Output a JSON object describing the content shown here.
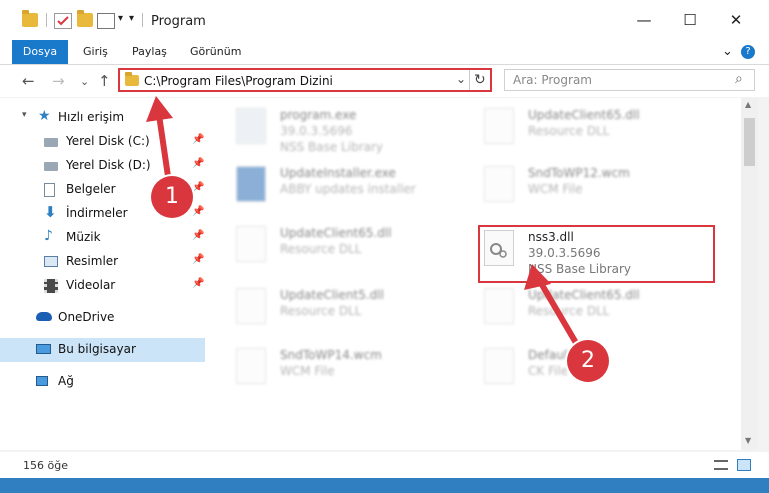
{
  "window": {
    "title": "Program",
    "minimize_glyph": "—",
    "maximize_glyph": "☐",
    "close_glyph": "✕"
  },
  "ribbon": {
    "tabs": [
      "Dosya",
      "Giriş",
      "Paylaş",
      "Görünüm"
    ],
    "expand_glyph": "⌄",
    "help_glyph": "?"
  },
  "navigation": {
    "back_glyph": "←",
    "forward_glyph": "→",
    "recent_glyph": "⌄",
    "up_glyph": "↑"
  },
  "address_bar": {
    "path": "C:\\Program Files\\Program Dizini",
    "dropdown_glyph": "⌄",
    "refresh_glyph": "↻"
  },
  "search": {
    "placeholder": "Ara: Program",
    "search_glyph": "⌕"
  },
  "sidebar": {
    "pin_glyph": "📌",
    "items": [
      {
        "label": "Hızlı erişim",
        "icon": "star-icon"
      },
      {
        "label": "Yerel Disk (C:)",
        "icon": "disk-icon"
      },
      {
        "label": "Yerel Disk (D:)",
        "icon": "disk-icon"
      },
      {
        "label": "Belgeler",
        "icon": "documents-icon"
      },
      {
        "label": "İndirmeler",
        "icon": "download-icon"
      },
      {
        "label": "Müzik",
        "icon": "music-icon"
      },
      {
        "label": "Resimler",
        "icon": "pictures-icon"
      },
      {
        "label": "Videolar",
        "icon": "video-icon"
      },
      {
        "label": "OneDrive",
        "icon": "cloud-icon"
      },
      {
        "label": "Bu bilgisayar",
        "icon": "computer-icon"
      },
      {
        "label": "Ağ",
        "icon": "network-icon"
      }
    ]
  },
  "files": [
    {
      "name": "program.exe",
      "version": "39.0.3.5696",
      "desc": "NSS Base Library"
    },
    {
      "name": "UpdateClient65.dll",
      "version": "Resource DLL",
      "desc": ""
    },
    {
      "name": "UpdateInstaller.exe",
      "version": "ABBY updates installer",
      "desc": ""
    },
    {
      "name": "SndToWP12.wcm",
      "version": "WCM File",
      "desc": ""
    },
    {
      "name": "UpdateClient65.dll",
      "version": "Resource DLL",
      "desc": ""
    },
    {
      "name": "nss3.dll",
      "version": "39.0.3.5696",
      "desc": "NSS Base Library"
    },
    {
      "name": "UpdateClient5.dll",
      "version": "Resource DLL",
      "desc": ""
    },
    {
      "name": "UpdateClient65.dll",
      "version": "Resource DLL",
      "desc": ""
    },
    {
      "name": "SndToWP14.wcm",
      "version": "WCM File",
      "desc": ""
    },
    {
      "name": "Default.pck",
      "version": "CK File",
      "desc": ""
    }
  ],
  "status": {
    "count": "156 öğe"
  },
  "markers": [
    "1",
    "2"
  ],
  "colors": {
    "accent": "#1979ca",
    "highlight": "#d9363e"
  }
}
